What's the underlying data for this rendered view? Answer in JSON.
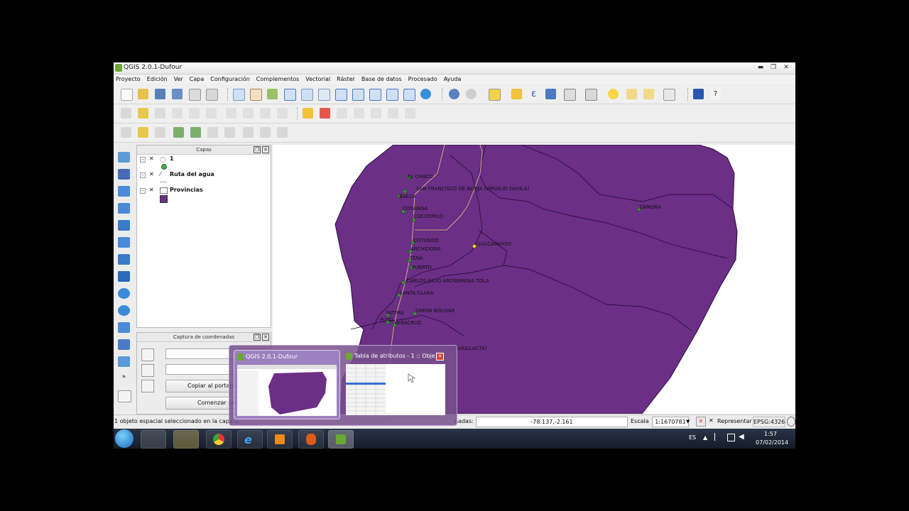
{
  "window": {
    "title": "QGIS 2.0.1-Dufour",
    "controls": [
      "▬",
      "❐",
      "✕"
    ]
  },
  "menu": [
    "Proyecto",
    "Edición",
    "Ver",
    "Capa",
    "Configuración",
    "Complementos",
    "Vectorial",
    "Ráster",
    "Base de datos",
    "Procesado",
    "Ayuda"
  ],
  "layers_panel": {
    "title": "Capas",
    "layers": [
      {
        "name": "1"
      },
      {
        "name": "Ruta del agua"
      },
      {
        "name": "Provincias"
      }
    ]
  },
  "coords_panel": {
    "title": "Captura de coordenadas",
    "copy_button": "Copiar al portapa",
    "start_button": "Comenzar cap"
  },
  "map": {
    "fill_color": "#6b2f86",
    "labels": [
      "EL CHACO",
      "SAN FRANCISCO DE BORJA (VIRGILIO DAVILA)",
      "BAEZA",
      "COSANGA",
      "COCODRILO",
      "ZAMORA",
      "GUACAMAYOS",
      "COTUNDO",
      "ARCHIDONA",
      "TENA",
      "PUERTO",
      "CARLOS JULIO AROSEMENA TOLA",
      "SANTA CLARA",
      "FATIMA",
      "SIMON BOLIVAR",
      "PUYO",
      "VERACRUZ",
      "SHULLACTA)"
    ]
  },
  "status": {
    "message": "1 objeto espacial seleccionado en la capa 1.",
    "coord_label": "nadas:",
    "coord_value": "-78.137,-2.161",
    "scale_label": "Escala",
    "scale_value": "1:1670781",
    "render_label": "Representar",
    "crs": "EPSG:4326"
  },
  "taskbar_preview": {
    "items": [
      {
        "title": "QGIS 2.0.1-Dufour"
      },
      {
        "title": "Tabla de atributos - 1 :: Obje..."
      }
    ]
  },
  "tray": {
    "language": "ES",
    "time": "1:57",
    "date": "07/02/2014"
  }
}
